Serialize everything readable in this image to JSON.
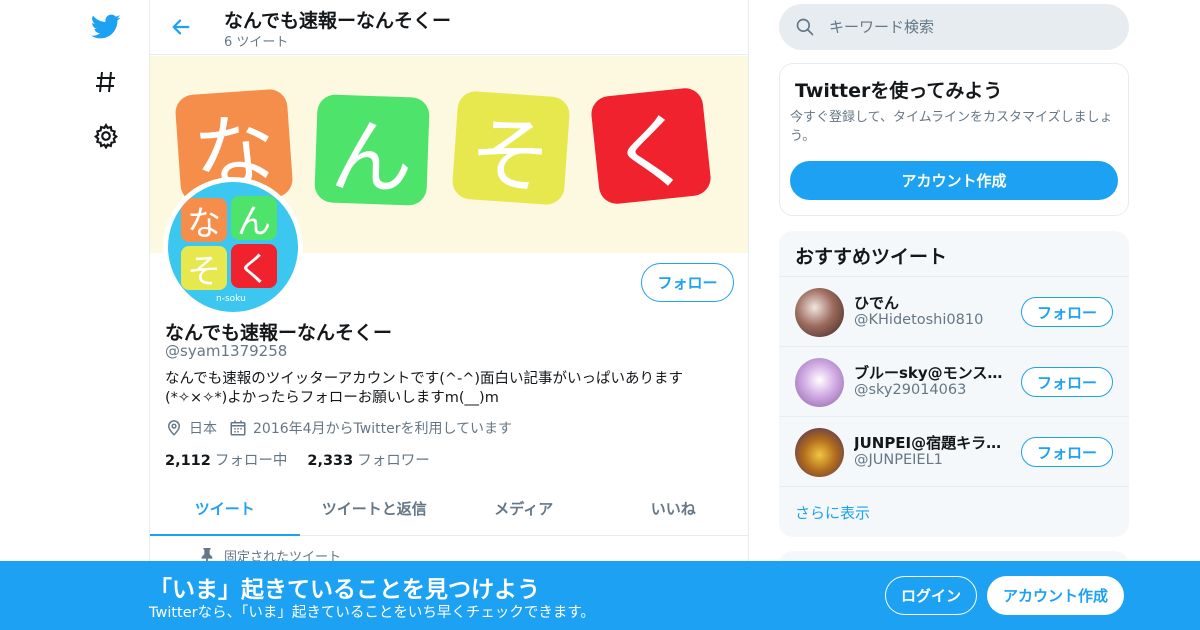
{
  "brand_color": "#1da1f2",
  "nav": {
    "icons": [
      "twitter-logo-icon",
      "hashtag-icon",
      "gear-icon"
    ]
  },
  "header": {
    "title": "なんでも速報ーなんそくー",
    "tweet_count": "6 ツイート"
  },
  "banner": {
    "tiles": [
      {
        "char": "な",
        "color": "#f58d4b"
      },
      {
        "char": "ん",
        "color": "#4ee36a"
      },
      {
        "char": "そ",
        "color": "#e6e84e"
      },
      {
        "char": "く",
        "color": "#f0222d"
      }
    ]
  },
  "avatar": {
    "tiles": [
      "な",
      "ん",
      "そ",
      "く"
    ],
    "caption": "n-soku"
  },
  "profile": {
    "follow_label": "フォロー",
    "name": "なんでも速報ーなんそくー",
    "handle": "@syam1379258",
    "bio": "なんでも速報のツイッターアカウントです(^-^)面白い記事がいっぱいあります(*✧×✧*)よかったらフォローお願いしますm(__)m",
    "location": "日本",
    "joined": "2016年4月からTwitterを利用しています",
    "following_count": "2,112",
    "following_label": "フォロー中",
    "followers_count": "2,333",
    "followers_label": "フォロワー"
  },
  "tabs": [
    {
      "label": "ツイート",
      "active": true
    },
    {
      "label": "ツイートと返信",
      "active": false
    },
    {
      "label": "メディア",
      "active": false
    },
    {
      "label": "いいね",
      "active": false
    }
  ],
  "pinned_label": "固定されたツイート",
  "search": {
    "placeholder": "キーワード検索"
  },
  "signup_card": {
    "title": "Twitterを使ってみよう",
    "text": "今すぐ登録して、タイムラインをカスタマイズしましょう。",
    "button": "アカウント作成"
  },
  "recommended": {
    "title": "おすすめツイート",
    "items": [
      {
        "name": "ひでん",
        "handle": "@KHidetoshi0810",
        "follow": "フォロー"
      },
      {
        "name": "ブルーsky@モンスト…",
        "handle": "@sky29014063",
        "follow": "フォロー"
      },
      {
        "name": "JUNPEI@宿題キラー…",
        "handle": "@JUNPEIEL1",
        "follow": "フォロー"
      }
    ],
    "show_more": "さらに表示"
  },
  "bottom_bar": {
    "title": "「いま」起きていることを見つけよう",
    "subtitle": "Twitterなら、「いま」起きていることをいち早くチェックできます。",
    "login": "ログイン",
    "signup": "アカウント作成"
  }
}
